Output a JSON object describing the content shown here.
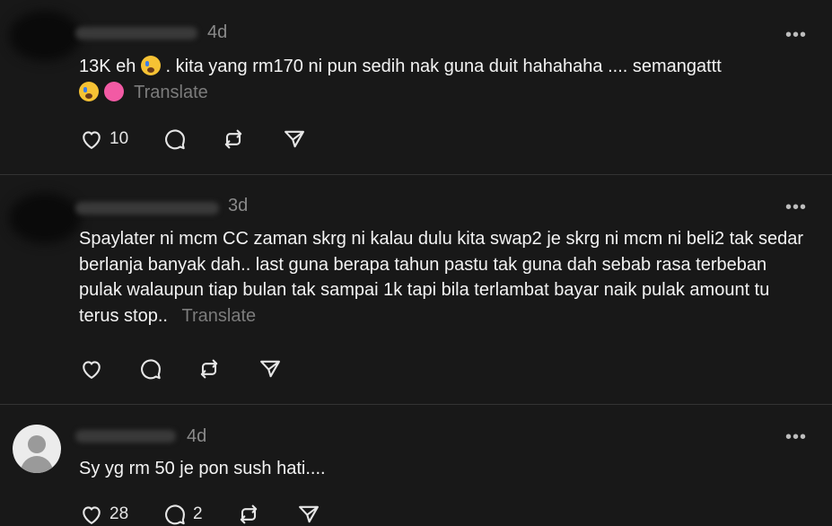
{
  "posts": [
    {
      "time": "4d",
      "text_a": "13K eh ",
      "text_b": " . kita yang rm170 ni pun sedih nak guna duit hahahaha .... semangattt",
      "emoji_1": "crying-face",
      "emoji_2": "crying-face",
      "emoji_3": "pink-heart",
      "translate": "Translate",
      "likes": "10",
      "replies": "",
      "reposts": ""
    },
    {
      "time": "3d",
      "text": "Spaylater ni mcm CC zaman skrg ni kalau dulu kita swap2 je skrg ni mcm ni beli2 tak sedar berlanja banyak dah.. last guna berapa tahun pastu tak guna dah sebab rasa terbeban pulak walaupun tiap bulan tak sampai 1k tapi bila terlambat bayar naik pulak amount tu terus stop..",
      "translate": "Translate",
      "likes": "",
      "replies": "",
      "reposts": ""
    },
    {
      "time": "4d",
      "text": "Sy yg rm 50 je pon sush hati....",
      "likes": "28",
      "replies": "2",
      "reposts": ""
    }
  ],
  "more_label": "•••",
  "icons": {
    "like": "heart-icon",
    "reply": "comment-icon",
    "repost": "repost-icon",
    "share": "send-icon",
    "more": "more-horizontal-icon"
  },
  "colors": {
    "background": "#181818",
    "text": "#f3f3f3",
    "muted": "#8a8a8a",
    "divider": "#333333"
  }
}
